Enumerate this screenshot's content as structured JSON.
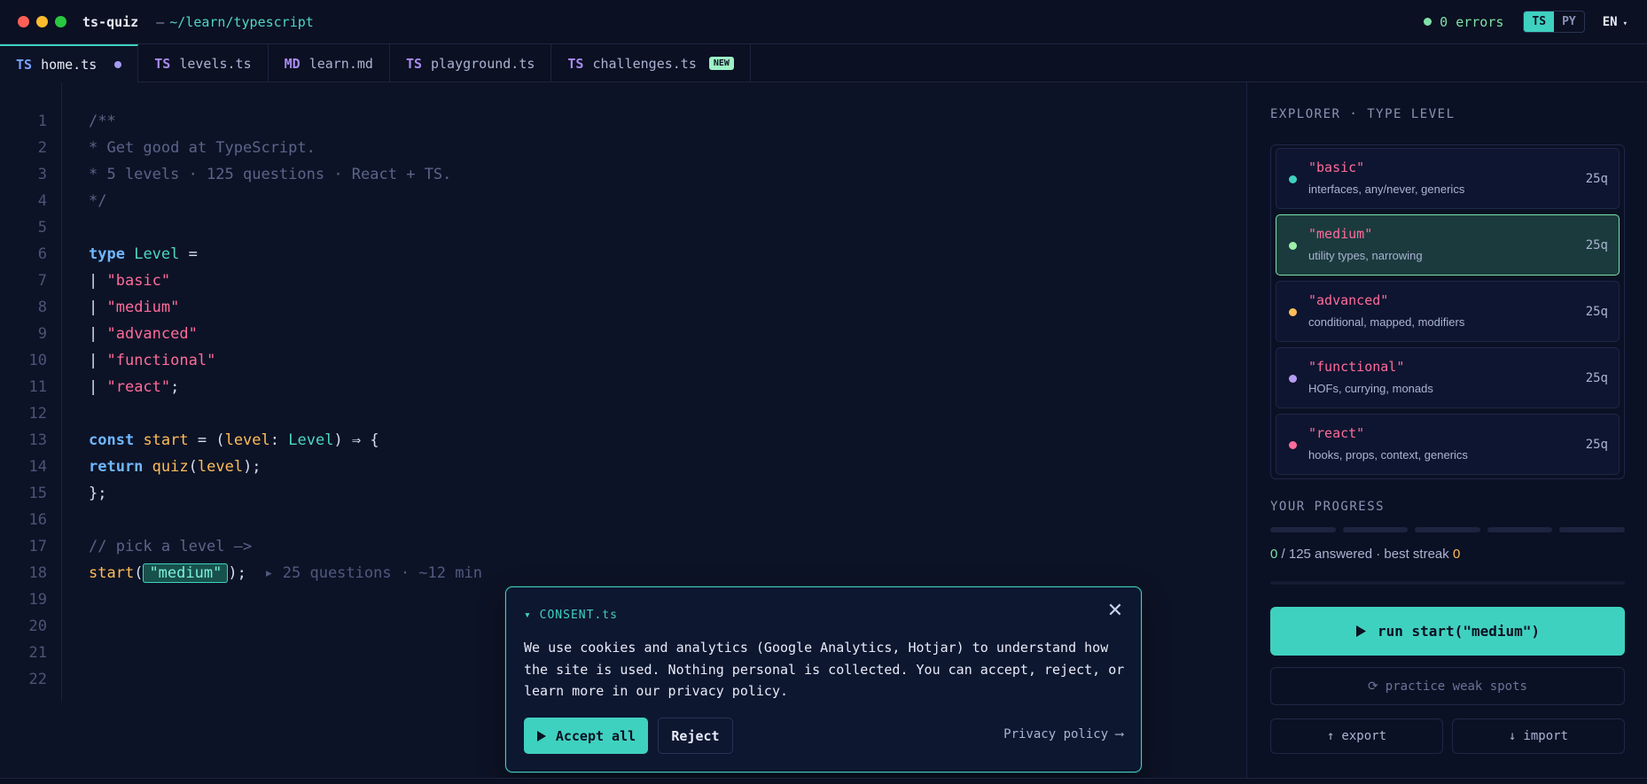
{
  "titlebar": {
    "app_name": "ts-quiz",
    "path_dash": "—",
    "path": "~/learn/typescript",
    "errors": "0 errors",
    "lang_ts": "TS",
    "lang_py": "PY",
    "locale": "EN",
    "locale_caret": "▾"
  },
  "tabs": [
    {
      "type": "TS",
      "name": "home.ts"
    },
    {
      "type": "TS",
      "name": "levels.ts"
    },
    {
      "type": "MD",
      "name": "learn.md"
    },
    {
      "type": "TS",
      "name": "playground.ts"
    },
    {
      "type": "TS",
      "name": "challenges.ts",
      "badge": "NEW"
    }
  ],
  "editor": {
    "line_numbers": [
      "1",
      "2",
      "3",
      "4",
      "5",
      "6",
      "7",
      "8",
      "9",
      "10",
      "11",
      "12",
      "13",
      "14",
      "15",
      "16",
      "17",
      "18",
      "19",
      "20",
      "21",
      "22"
    ],
    "comment_open": "/**",
    "comment_1": "* Get good at TypeScript.",
    "comment_2": "* 5 levels · 125 questions · React + TS.",
    "comment_close": "*/",
    "kw_type": "type",
    "type_name": "Level",
    "eq": " =",
    "pipe": "| ",
    "levels": [
      "\"basic\"",
      "\"medium\"",
      "\"advanced\"",
      "\"functional\"",
      "\"react\""
    ],
    "semicolon": ";",
    "kw_const": "const",
    "fn_start": "start",
    "assign_paren": " = (",
    "param": "level",
    "colon": ": ",
    "arrow": ") ⇒ {",
    "kw_return": "return",
    "fn_quiz": "quiz",
    "open_paren": "(",
    "close_stmt": ");",
    "close_brace": "};",
    "pick_comment": "// pick a level —>",
    "selected_level": "\"medium\"",
    "hint": "▸ 25 questions · ~12 min"
  },
  "consent": {
    "title": "▾  CONSENT.ts",
    "close": "✕",
    "body": "We use cookies and analytics (Google Analytics, Hotjar) to understand how the site is used. Nothing personal is collected. You can accept, reject, or learn more in our privacy policy.",
    "accept": "Accept all",
    "reject": "Reject",
    "privacy": "Privacy policy ⟶"
  },
  "sidebar": {
    "explorer_label": "EXPLORER · TYPE LEVEL",
    "levels": [
      {
        "name": "\"basic\"",
        "desc": "interfaces, any/never, generics",
        "count": "25q",
        "color": "#3fd1bf"
      },
      {
        "name": "\"medium\"",
        "desc": "utility types, narrowing",
        "count": "25q",
        "color": "#9ef0a8"
      },
      {
        "name": "\"advanced\"",
        "desc": "conditional, mapped, modifiers",
        "count": "25q",
        "color": "#ffbd59"
      },
      {
        "name": "\"functional\"",
        "desc": "HOFs, currying, monads",
        "count": "25q",
        "color": "#b69cf2"
      },
      {
        "name": "\"react\"",
        "desc": "hooks, props, context, generics",
        "count": "25q",
        "color": "#ff6b9a"
      }
    ],
    "selected_index": 1,
    "progress_label": "YOUR PROGRESS",
    "progress_answered": "0",
    "progress_total": " / 125 answered · best streak ",
    "progress_streak": "0",
    "run_label": "run start(\"medium\")",
    "practice_label": "practice weak spots",
    "export_label": "export",
    "import_label": "import"
  },
  "colors": {
    "accent": "#3fd1bf",
    "string": "#ff6b9a",
    "keyword": "#6fb6ff",
    "function": "#ffbd59"
  }
}
